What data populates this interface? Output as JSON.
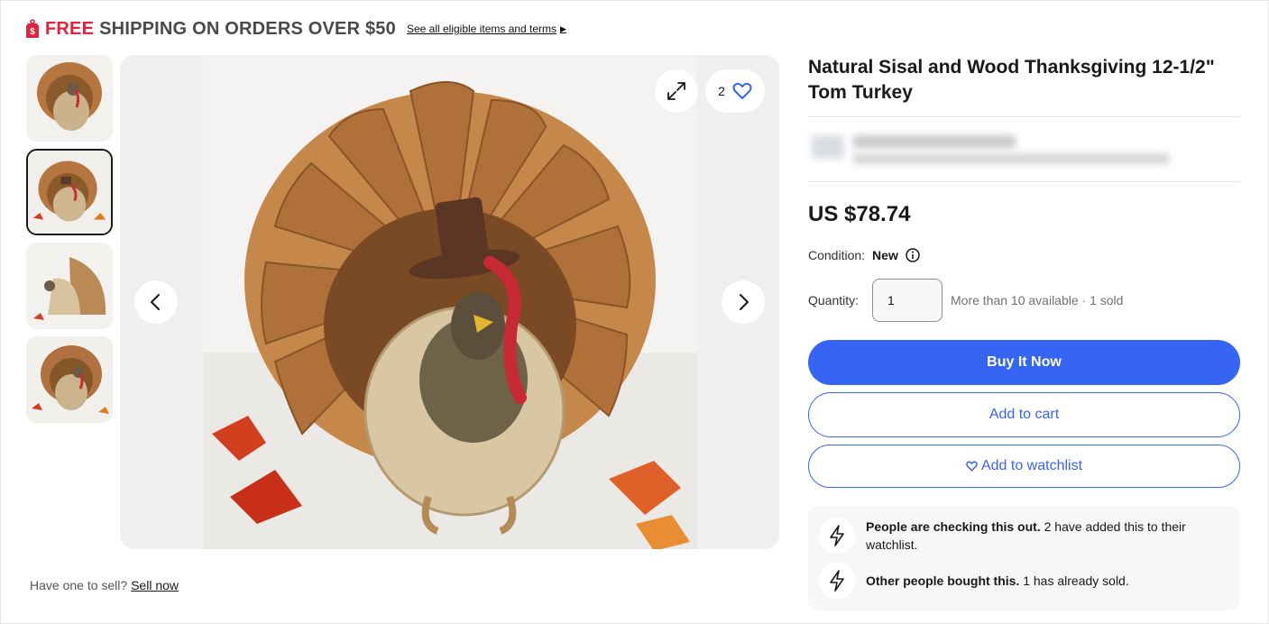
{
  "promo": {
    "free": "FREE",
    "rest": "SHIPPING ON ORDERS OVER $50",
    "link": "See all eligible items and terms",
    "accent": "#e0243b"
  },
  "gallery": {
    "thumbnails": [
      {
        "alt": "turkey-front"
      },
      {
        "alt": "turkey-with-leaves"
      },
      {
        "alt": "turkey-side"
      },
      {
        "alt": "turkey-angle"
      }
    ],
    "selected_index": 1,
    "favorite_count": "2",
    "icons": {
      "expand": "expand-icon",
      "favorite": "heart-icon",
      "prev": "chevron-left-icon",
      "next": "chevron-right-icon"
    }
  },
  "sell": {
    "prompt": "Have one to sell?",
    "link": "Sell now"
  },
  "item": {
    "title": "Natural Sisal and Wood Thanksgiving 12-1/2\" Tom Turkey",
    "price": "US $78.74",
    "condition_label": "Condition:",
    "condition_value": "New",
    "quantity_label": "Quantity:",
    "quantity_value": "1",
    "availability": "More than 10 available · 1 sold"
  },
  "actions": {
    "buy_now": "Buy It Now",
    "add_to_cart": "Add to cart",
    "add_to_watchlist": "Add to watchlist",
    "primary_color": "#3665f3"
  },
  "signals": [
    {
      "bold": "People are checking this out.",
      "text": " 2 have added this to their watchlist.",
      "icon": "lightning-icon"
    },
    {
      "bold": "Other people bought this.",
      "text": " 1 has already sold.",
      "icon": "lightning-icon"
    }
  ]
}
